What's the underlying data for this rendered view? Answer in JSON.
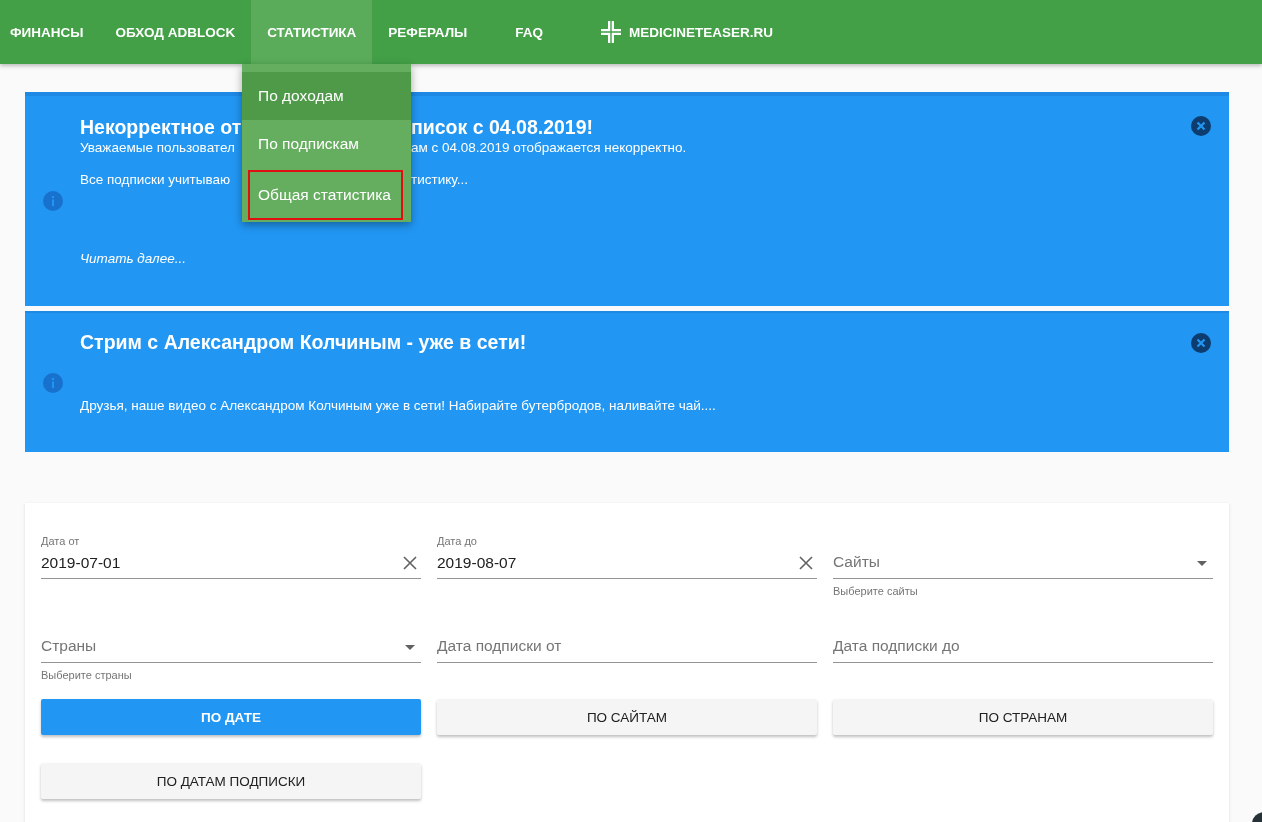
{
  "nav": {
    "items": [
      {
        "label": "ФИНАНСЫ",
        "kind": "link",
        "selected": false
      },
      {
        "label": "ОБХОД ADBLOCK",
        "kind": "link",
        "selected": false
      },
      {
        "label": "СТАТИСТИКА",
        "kind": "link",
        "selected": true
      },
      {
        "label": "РЕФЕРАЛЫ",
        "kind": "link",
        "selected": false
      },
      {
        "label": "FAQ",
        "kind": "link",
        "selected": false
      },
      {
        "label": "MEDICINETEASER.RU",
        "kind": "logo",
        "selected": false
      }
    ]
  },
  "dropdown": {
    "items": [
      {
        "label": "По доходам",
        "hovered": true,
        "outlined": false
      },
      {
        "label": "По подпискам",
        "hovered": false,
        "outlined": false
      },
      {
        "label": "Общая статистика",
        "hovered": false,
        "outlined": true
      }
    ]
  },
  "alerts": [
    {
      "title_parts": [
        "Некорректное от",
        "писок с 04.08.2019!"
      ],
      "lines": [
        [
          "Уважаемые пользовател",
          "ам с 04.08.2019 отображается некорректно."
        ],
        [
          "Все подписки учитываю",
          "тистику..."
        ]
      ],
      "link": "Читать далее..."
    },
    {
      "title": "Стрим с Александром Колчиным - уже в сети!",
      "text": "Друзья, наше видео с Александром Колчиным уже в сети! Набирайте бутербродов, наливайте чай...."
    }
  ],
  "filters": {
    "fields": [
      {
        "kind": "date",
        "label": "Дата от",
        "value": "2019-07-01"
      },
      {
        "kind": "date",
        "label": "Дата до",
        "value": "2019-08-07"
      },
      {
        "kind": "select",
        "placeholder": "Сайты",
        "hint": "Выберите сайты"
      },
      {
        "kind": "select",
        "placeholder": "Страны",
        "hint": "Выберите страны"
      },
      {
        "kind": "text",
        "placeholder": "Дата подписки от"
      },
      {
        "kind": "text",
        "placeholder": "Дата подписки до"
      }
    ],
    "buttons": [
      {
        "label": "ПО ДАТЕ",
        "primary": true
      },
      {
        "label": "ПО САЙТАМ",
        "primary": false
      },
      {
        "label": "ПО СТРАНАМ",
        "primary": false
      },
      {
        "label": "ПО ДАТАМ ПОДПИСКИ",
        "primary": false
      }
    ]
  }
}
